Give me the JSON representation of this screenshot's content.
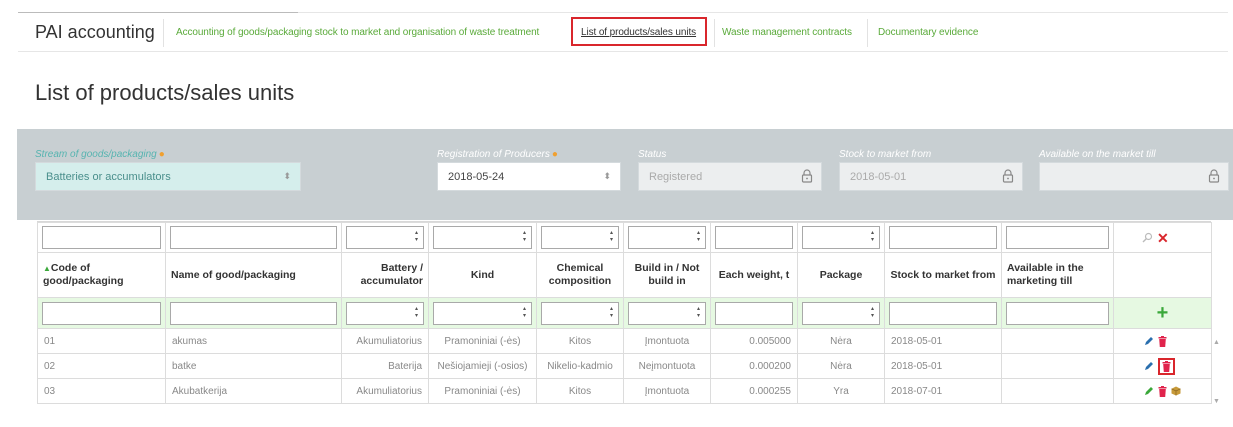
{
  "nav": {
    "brand": "PAI accounting",
    "links": [
      {
        "label": "Accounting of goods/packaging stock to market and organisation of waste treatment",
        "active": false
      },
      {
        "label": "List of products/sales units",
        "active": true
      },
      {
        "label": "Waste management contracts",
        "active": false
      },
      {
        "label": "Documentary evidence",
        "active": false
      }
    ]
  },
  "page_title": "List of products/sales units",
  "filters": {
    "stream": {
      "label": "Stream of goods/packaging",
      "value": "Batteries or accumulators"
    },
    "registration": {
      "label": "Registration of Producers",
      "value": "2018-05-24"
    },
    "status": {
      "label": "Status",
      "value": "Registered"
    },
    "stock_from": {
      "label": "Stock to market from",
      "value": "2018-05-01"
    },
    "available_till": {
      "label": "Available on the market till",
      "value": ""
    }
  },
  "table": {
    "headers": [
      "Code of good/packaging",
      "Name of good/packaging",
      "Battery / accumulator",
      "Kind",
      "Chemical composition",
      "Build in / Not build in",
      "Each weight, t",
      "Package",
      "Stock to market from",
      "Available in the marketing till"
    ],
    "rows": [
      [
        "01",
        "akumas",
        "Akumuliatorius",
        "Pramoniniai (-ės)",
        "Kitos",
        "Įmontuota",
        "0.005000",
        "Nėra",
        "2018-05-01",
        ""
      ],
      [
        "02",
        "batke",
        "Baterija",
        "Nešiojamieji (-osios)",
        "Nikelio-kadmio",
        "Neįmontuota",
        "0.000200",
        "Nėra",
        "2018-05-01",
        ""
      ],
      [
        "03",
        "Akubatkerija",
        "Akumuliatorius",
        "Pramoniniai (-ės)",
        "Kitos",
        "Įmontuota",
        "0.000255",
        "Yra",
        "2018-07-01",
        ""
      ]
    ],
    "add_label": "+"
  },
  "colors": {
    "accent_green": "#5aaa3a",
    "highlight_red": "#d9262c",
    "filter_panel": "#c8cfd2",
    "add_row": "#e6f9e2"
  },
  "icons": [
    "lock-icon",
    "search-icon",
    "clear-filter-icon",
    "pencil-icon",
    "trash-icon",
    "package-icon"
  ]
}
